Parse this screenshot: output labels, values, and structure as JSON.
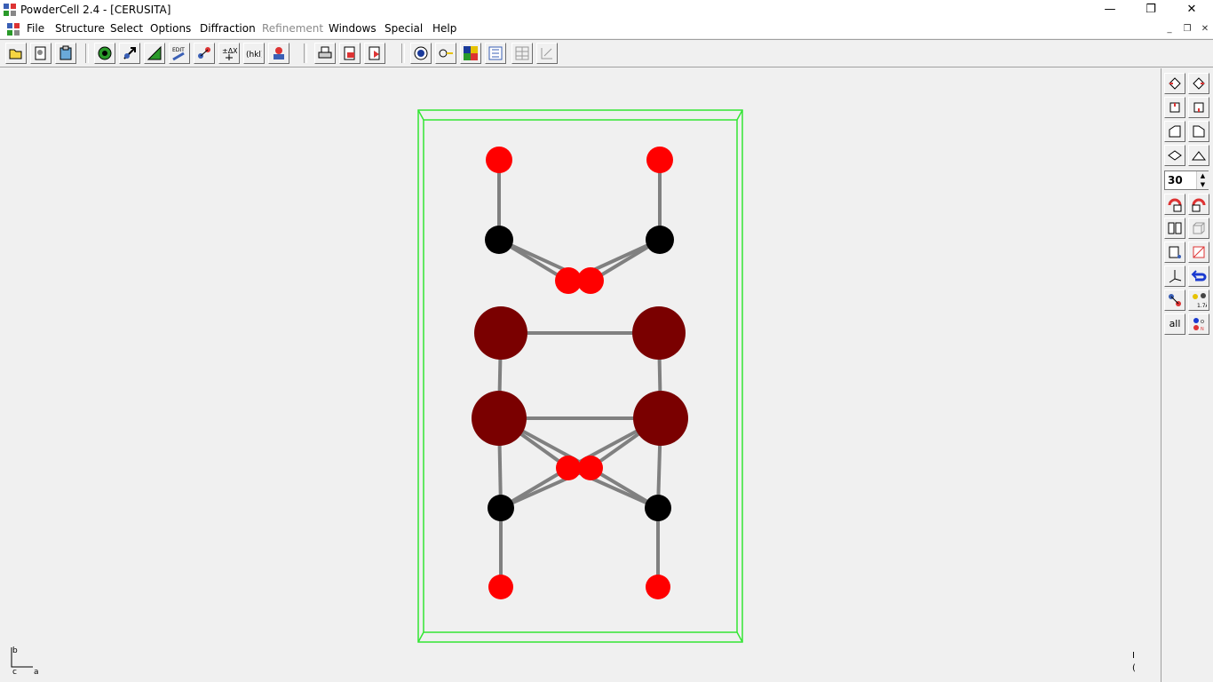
{
  "window": {
    "title": "PowderCell 2.4 - [CERUSITA]",
    "minimize": "—",
    "restore": "❐",
    "close": "✕"
  },
  "menu": {
    "items": [
      {
        "label": "File",
        "enabled": true
      },
      {
        "label": "Structure",
        "enabled": true
      },
      {
        "label": "Select",
        "enabled": true
      },
      {
        "label": "Options",
        "enabled": true
      },
      {
        "label": "Diffraction",
        "enabled": true
      },
      {
        "label": "Refinement",
        "enabled": false
      },
      {
        "label": "Windows",
        "enabled": true
      },
      {
        "label": "Special",
        "enabled": true
      },
      {
        "label": "Help",
        "enabled": true
      }
    ],
    "mdi": {
      "minimize": "_",
      "restore": "❐",
      "close": "✕"
    }
  },
  "toolbar": {
    "icons": [
      "open-icon",
      "load-structure-icon",
      "clipboard-icon",
      "diffraction-ring-icon",
      "select-tool-icon",
      "volume-icon",
      "edit-icon",
      "atom-move-icon",
      "transform-icon",
      "hkl-icon",
      "scale-icon",
      "print-icon",
      "print-preview-icon",
      "export-icon",
      "sphere-view-icon",
      "lattice-icon",
      "color-icon",
      "pattern-icon",
      "table-icon",
      "structure-info-icon"
    ]
  },
  "rightpanel": {
    "rotation_step": "30",
    "all_label": "all",
    "rotate_icons": [
      "rotate-x-plus-icon",
      "rotate-x-minus-icon",
      "rotate-y-plus-icon",
      "rotate-y-minus-icon",
      "rotate-z-plus-icon",
      "rotate-z-minus-icon",
      "view-down-icon",
      "view-up-icon"
    ],
    "tool_icons": [
      "magnet-icon",
      "magnet-reverse-icon",
      "book-icon",
      "cube-outline-icon",
      "cell-icon",
      "cell-disabled-icon",
      "axes-icon",
      "undo-rotate-icon",
      "bond-icon",
      "distance-icon",
      "labels-icon"
    ]
  },
  "colors": {
    "cell_box": "#33e633",
    "atom_pb": "#7a0000",
    "atom_c": "#000000",
    "atom_o": "#ff0000",
    "bond": "#808080"
  },
  "axes_labels": {
    "b": "b",
    "c": "c",
    "a": "a"
  },
  "status_glyph_1": "I",
  "status_glyph_2": "("
}
